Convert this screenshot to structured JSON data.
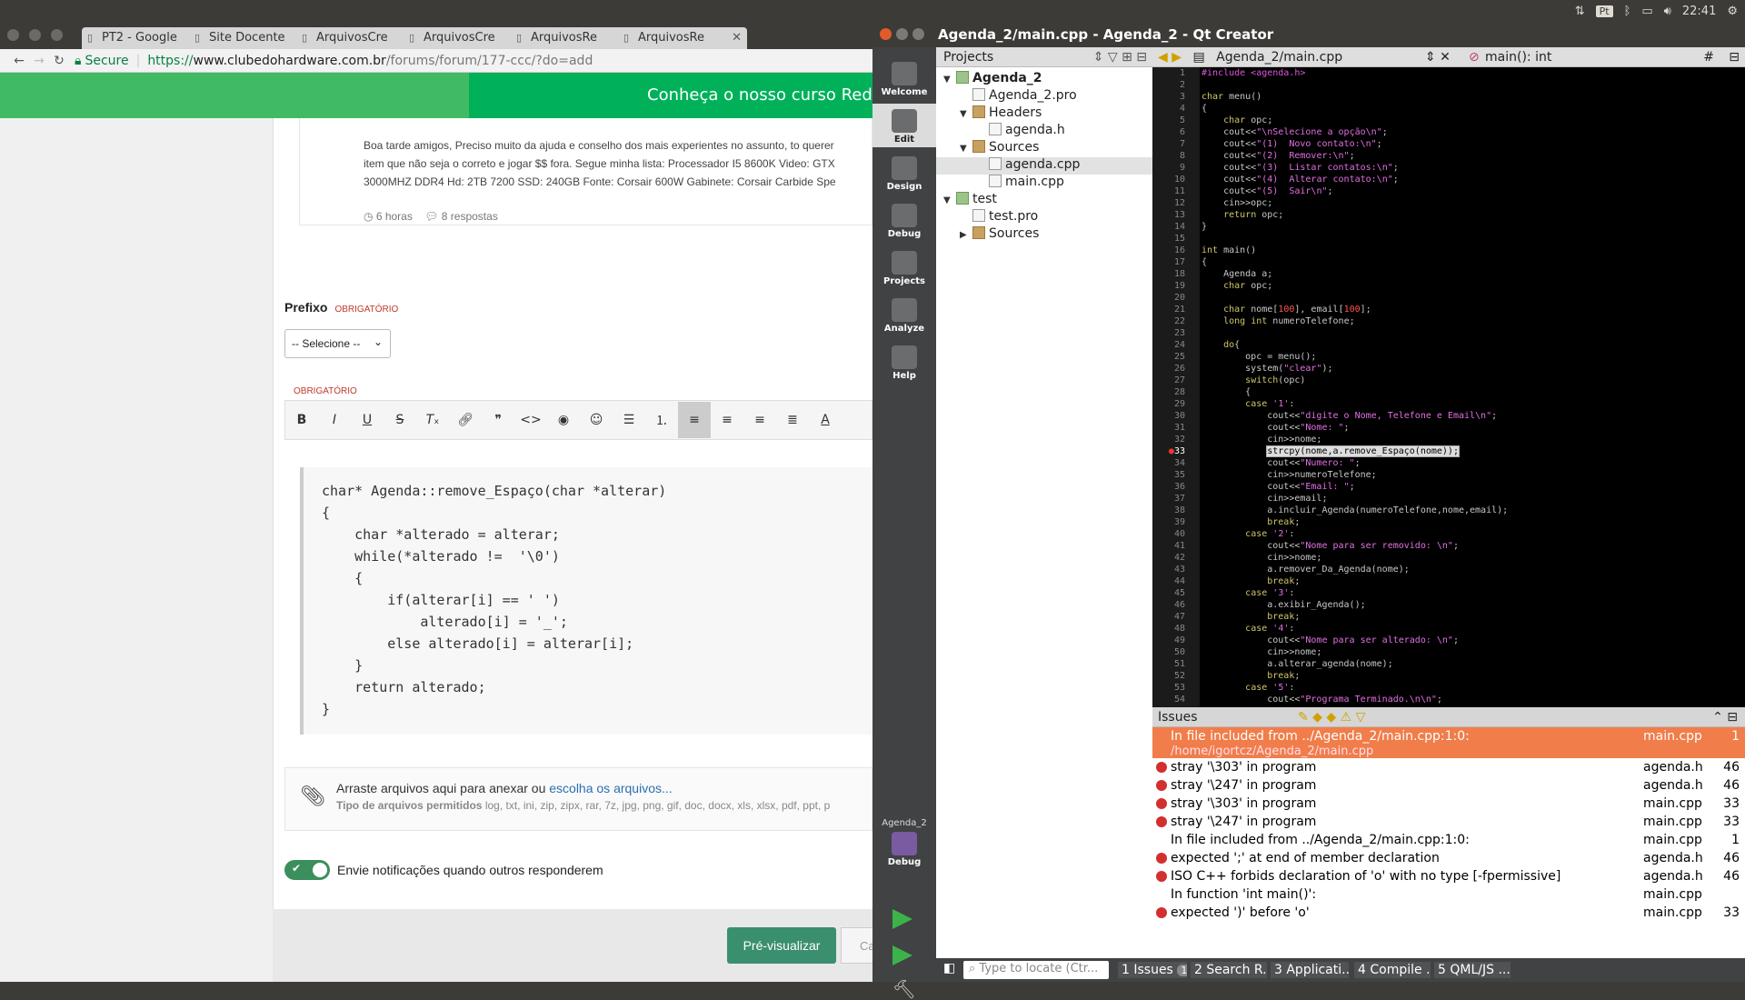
{
  "panel": {
    "lang": "Pt",
    "time": "22:41"
  },
  "chrome": {
    "tabs": [
      "PT2 - Google",
      "Site Docente",
      "ArquivosCre",
      "ArquivosCre",
      "ArquivosRe",
      "ArquivosRe"
    ],
    "address": {
      "secure": "Secure",
      "scheme": "https://",
      "host": "www.clubedohardware.com.br",
      "path": "/forums/forum/177-ccc/?do=add"
    },
    "banner": "Conheça o nosso curso Redes",
    "topic": {
      "line1": "Boa tarde amigos, Preciso muito da ajuda e conselho dos mais experientes no assunto, to querer",
      "line2": "item que não seja o correto e jogar $$ fora. Segue minha lista: Processador I5 8600K Video: GTX",
      "line3": "3000MHZ DDR4 Hd: 2TB 7200 SSD: 240GB Fonte: Corsair 600W Gabinete: Corsair Carbide Spe",
      "time": "6 horas",
      "replies": "8 respostas"
    },
    "prefix": {
      "label": "Prefixo",
      "required": "OBRIGATÓRIO",
      "select": "-- Selecione --"
    },
    "content_required": "OBRIGATÓRIO",
    "code": [
      "char* Agenda::remove_Espaço(char *alterar)",
      "{",
      "    char *alterado = alterar;",
      "    while(*alterado !=  '\\0')",
      "    {",
      "        if(alterar[i] == ' ')",
      "            alterado[i] = '_';",
      "        else alterado[i] = alterar[i];",
      "    }",
      "    return alterado;",
      "}"
    ],
    "attach": {
      "text": "Arraste arquivos aqui para anexar ou ",
      "link": "escolha os arquivos...",
      "types_label": "Tipo de arquivos permitidos",
      "types": " log, txt, ini, zip, zipx, rar, 7z, jpg, png, gif, doc, docx, xls, xlsx, pdf, ppt, p"
    },
    "notify": "Envie notificações quando outros responderem",
    "preview": "Pré-visualizar",
    "cancel": "Ca"
  },
  "qt": {
    "title": "Agenda_2/main.cpp - Agenda_2 - Qt Creator",
    "modes": [
      "Welcome",
      "Edit",
      "Design",
      "Debug",
      "Projects",
      "Analyze",
      "Help"
    ],
    "kit": "Agenda_2",
    "kit_mode": "Debug",
    "projects_label": "Projects",
    "tree": [
      {
        "t": "Agenda_2",
        "d": 0,
        "k": "pj",
        "a": "▼",
        "b": true
      },
      {
        "t": "Agenda_2.pro",
        "d": 1,
        "k": "fi",
        "a": ""
      },
      {
        "t": "Headers",
        "d": 1,
        "k": "fd",
        "a": "▼"
      },
      {
        "t": "agenda.h",
        "d": 2,
        "k": "fi",
        "a": ""
      },
      {
        "t": "Sources",
        "d": 1,
        "k": "fd",
        "a": "▼"
      },
      {
        "t": "agenda.cpp",
        "d": 2,
        "k": "fi",
        "a": "",
        "sel": true
      },
      {
        "t": "main.cpp",
        "d": 2,
        "k": "fi",
        "a": ""
      },
      {
        "t": "test",
        "d": 0,
        "k": "pj",
        "a": "▼"
      },
      {
        "t": "test.pro",
        "d": 1,
        "k": "fi",
        "a": ""
      },
      {
        "t": "Sources",
        "d": 1,
        "k": "fd",
        "a": "▶"
      }
    ],
    "file": "Agenda_2/main.cpp",
    "symbol": "main(): int",
    "hash": "#",
    "code": [
      "#include <agenda.h>",
      "",
      "char menu()",
      "{",
      "    char opc;",
      "    cout<<\"\\nSelecione a opção\\n\";",
      "    cout<<\"(1)  Novo contato:\\n\";",
      "    cout<<\"(2)  Remover:\\n\";",
      "    cout<<\"(3)  Listar contatos:\\n\";",
      "    cout<<\"(4)  Alterar contato:\\n\";",
      "    cout<<\"(5)  Sair\\n\";",
      "    cin>>opc;",
      "    return opc;",
      "}",
      "",
      "int main()",
      "{",
      "    Agenda a;",
      "    char opc;",
      "",
      "    char nome[100], email[100];",
      "    long int numeroTelefone;",
      "",
      "    do{",
      "        opc = menu();",
      "        system(\"clear\");",
      "        switch(opc)",
      "        {",
      "        case '1':",
      "            cout<<\"digite o Nome, Telefone e Email\\n\";",
      "            cout<<\"Nome: \";",
      "            cin>>nome;",
      "            strcpy(nome,a.remove_Espaço(nome));",
      "            cout<<\"Numero: \";",
      "            cin>>numeroTelefone;",
      "            cout<<\"Email: \";",
      "            cin>>email;",
      "            a.incluir_Agenda(numeroTelefone,nome,email);",
      "            break;",
      "        case '2':",
      "            cout<<\"Nome para ser removido: \\n\";",
      "            cin>>nome;",
      "            a.remover_Da_Agenda(nome);",
      "            break;",
      "        case '3':",
      "            a.exibir_Agenda();",
      "            break;",
      "        case '4':",
      "            cout<<\"Nome para ser alterado: \\n\";",
      "            cin>>nome;",
      "            a.alterar_agenda(nome);",
      "            break;",
      "        case '5':",
      "            cout<<\"Programa Terminado.\\n\\n\";"
    ],
    "issues_label": "Issues",
    "issues": [
      {
        "m": "In file included from ../Agenda_2/main.cpp:1:0:",
        "m2": "/home/igortcz/Agenda_2/main.cpp",
        "f": "main.cpp",
        "l": "1",
        "e": false,
        "sel": true
      },
      {
        "m": "stray '\\303' in program",
        "f": "agenda.h",
        "l": "46",
        "e": true
      },
      {
        "m": "stray '\\247' in program",
        "f": "agenda.h",
        "l": "46",
        "e": true
      },
      {
        "m": "stray '\\303' in program",
        "f": "main.cpp",
        "l": "33",
        "e": true
      },
      {
        "m": "stray '\\247' in program",
        "f": "main.cpp",
        "l": "33",
        "e": true
      },
      {
        "m": "In file included from ../Agenda_2/main.cpp:1:0:",
        "f": "main.cpp",
        "l": "1",
        "e": false
      },
      {
        "m": "expected ';' at end of member declaration",
        "f": "agenda.h",
        "l": "46",
        "e": true
      },
      {
        "m": "ISO C++ forbids declaration of 'o' with no type [-fpermissive]",
        "f": "agenda.h",
        "l": "46",
        "e": true
      },
      {
        "m": "In function 'int main()':",
        "f": "main.cpp",
        "l": "",
        "e": false
      },
      {
        "m": "expected ')' before 'o'",
        "f": "main.cpp",
        "l": "33",
        "e": true
      }
    ],
    "status": {
      "locate": "Type to locate (Ctr...",
      "panes": [
        "1 Issues",
        "2 Search R...",
        "3 Applicati...",
        "4 Compile ...",
        "5 QML/JS ..."
      ],
      "issue_count": "10"
    }
  }
}
